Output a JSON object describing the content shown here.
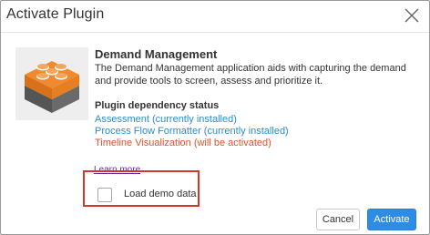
{
  "dialog": {
    "title": "Activate Plugin",
    "close_icon": "close-x-icon"
  },
  "plugin": {
    "logo_icon": "lego-brick-icon",
    "name": "Demand Management",
    "description": "The Demand Management application aids with capturing the demand and provide tools to screen, assess and prioritize it."
  },
  "dependencies": {
    "heading": "Plugin dependency status",
    "items": [
      {
        "label": "Assessment (currently installed)",
        "status": "installed",
        "color": "#2a8dd4"
      },
      {
        "label": "Process Flow Formatter (currently installed)",
        "status": "installed",
        "color": "#2a8dd4"
      },
      {
        "label": "Timeline Visualization (will be activated)",
        "status": "activate",
        "color": "#e0522b"
      }
    ]
  },
  "learn_more": "Learn more",
  "demo_data": {
    "label": "Load demo data",
    "checked": false
  },
  "buttons": {
    "cancel": "Cancel",
    "activate": "Activate"
  },
  "colors": {
    "accent": "#2f8ce4",
    "highlight_border": "#cf3a2a",
    "logo_orange": "#f08a2c",
    "logo_gray": "#5a5a5a"
  }
}
